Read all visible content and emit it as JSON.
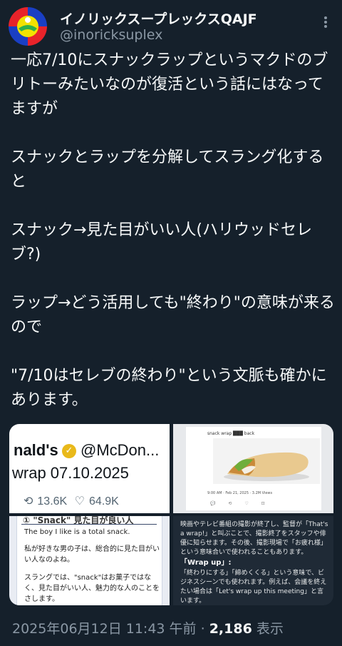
{
  "author": {
    "name": "イノリックスープレックスQAJF",
    "handle": "@inoricksuplex",
    "avatar_colors": [
      "#e8232a",
      "#1a3fc4",
      "#f2e200",
      "#2fb04a"
    ]
  },
  "post": {
    "paragraphs": [
      "一応7/10にスナックラップというマクドのブリトーみたいなのが復活という話にはなってますが",
      "スナックとラップを分解してスラング化すると",
      "スナック→見た目がいい人(ハリウッドセレブ?)",
      "ラップ→どう活用しても\"終わり\"の意味が来るので",
      "\"7/10はセレブの終わり\"という文脈も確かにあります。"
    ]
  },
  "images": {
    "img1": {
      "name_fragment": "nald's",
      "verified_icon": "verified-badge-icon",
      "handle_fragment": "@McDon...",
      "text": "wrap 07.10.2025",
      "retweets": "13.6K",
      "likes": "64.9K"
    },
    "img2": {
      "title": "snack wrap ███ back",
      "meta": "9:00 AM · Feb 21, 2025 · 3.2M Views",
      "actions": "💬 ⟲ ♡ ⊡"
    },
    "img3": {
      "heading": "① \"Snack\" 見た目が良い人",
      "example_en": "The boy I like is a total snack.",
      "example_jp": "私が好きな男の子は、総合的に見た目がいい人なのよね。",
      "note": "スラングでは、\"snack\"はお菓子ではなく、見た目がいい人、魅力的な人のことをさします。"
    },
    "img4": {
      "text1": "映画やテレビ番組の撮影が終了し、監督が「That's a wrap!」と叫ぶことで、撮影終了をスタッフや俳優に知らせます。その後、撮影現場で「お疲れ様」という意味合いで使われることもあります。",
      "heading": "「Wrap up」:",
      "text2": "「終わりにする」「締めくくる」という意味で、ビジネスシーンでも使われます。例えば、会議を終えたい場合は「Let's wrap up this meeting」と言います。"
    }
  },
  "footer": {
    "timestamp": "2025年06月12日 11:43 午前",
    "separator": "·",
    "views_count": "2,186",
    "views_label": "表示"
  }
}
